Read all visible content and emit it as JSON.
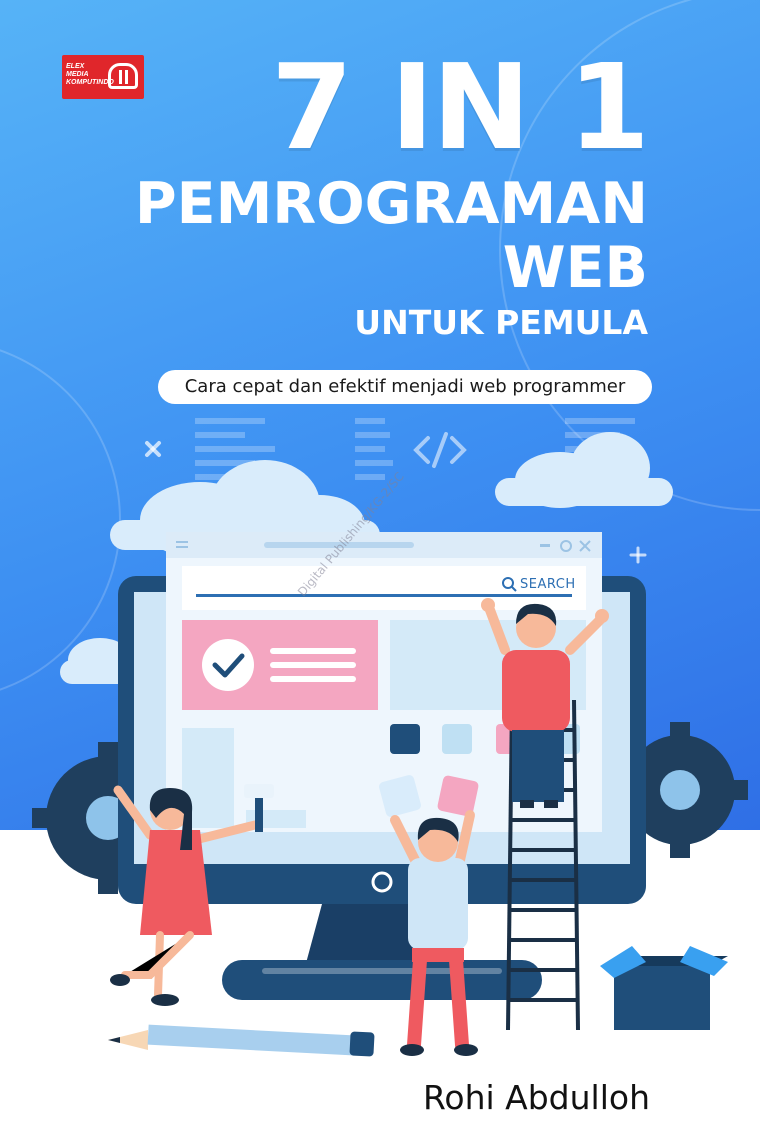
{
  "publisher": {
    "logo_text_lines": [
      "ELEX",
      "MEDIA",
      "KOMPUTINDO"
    ]
  },
  "title": {
    "line1": "7 IN 1",
    "line2": "PEMROGRAMAN",
    "line3": "WEB",
    "line4": "UNTUK PEMULA"
  },
  "subtitle": "Cara cepat dan efektif menjadi web programmer",
  "illustration": {
    "search_label": "SEARCH",
    "watermark": "Digital Publishing/KG-2/SC"
  },
  "author": "Rohi Abdulloh",
  "colors": {
    "sky_top": "#56b3f7",
    "sky_bottom": "#2f6fe6",
    "monitor_dark": "#1f4e7a",
    "accent_pink": "#f4a6c1",
    "accent_red": "#ef5a60",
    "gear": "#1f3f5e"
  },
  "icons": [
    "checkmark-icon",
    "search-icon",
    "code-tag-icon",
    "gear-icon",
    "cross-icon",
    "plus-icon"
  ]
}
